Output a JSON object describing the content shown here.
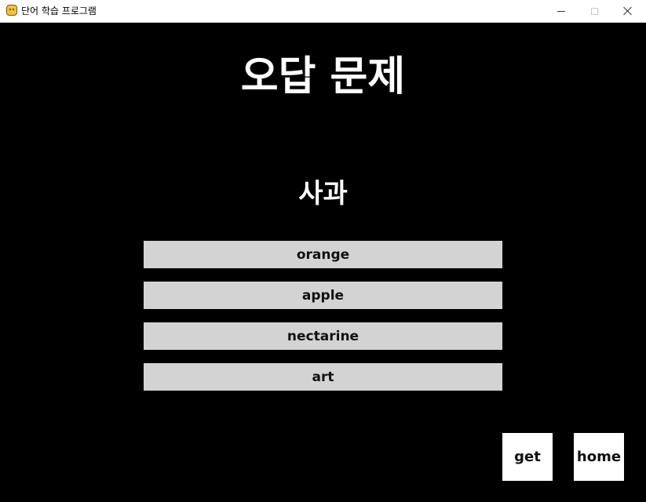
{
  "window": {
    "title": "단어 학습 프로그램"
  },
  "screen": {
    "title": "오답 문제",
    "question": "사과"
  },
  "choices": [
    {
      "label": "orange"
    },
    {
      "label": "apple"
    },
    {
      "label": "nectarine"
    },
    {
      "label": "art"
    }
  ],
  "buttons": {
    "get": "get",
    "home": "home"
  },
  "colors": {
    "background": "#000000",
    "choice_background": "#d3d3d3",
    "button_background": "#ffffff",
    "text_light": "#ffffff",
    "text_dark": "#111111"
  },
  "icons": {
    "app": "pygame-snake-icon",
    "minimize": "minimize-icon",
    "maximize": "maximize-icon",
    "close": "close-icon"
  }
}
